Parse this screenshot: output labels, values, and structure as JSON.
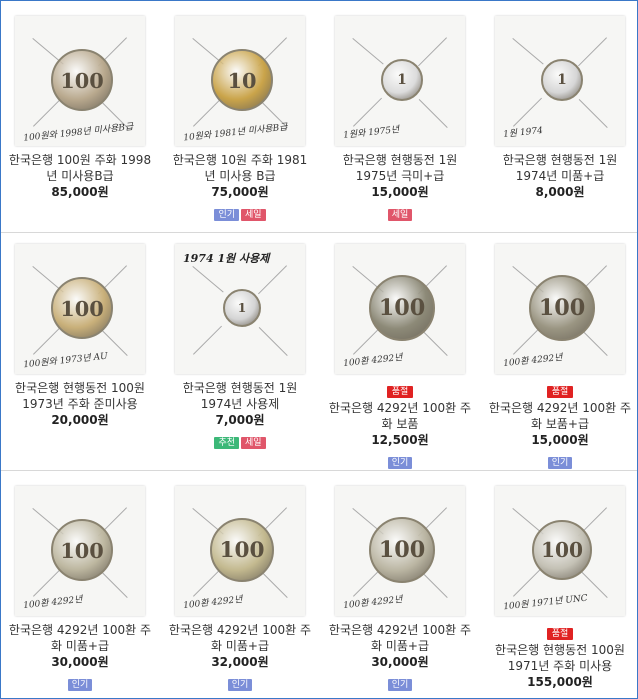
{
  "products": [
    {
      "name": "한국은행 100원 주화 1998년 미사용B급",
      "price": "85,000원",
      "badges": [],
      "sold_out": "",
      "coin_color": "#b9a98e",
      "coin_text": "100",
      "note": "100원와 1998년 미사용B급"
    },
    {
      "name": "한국은행 10원 주화 1981년 미사용 B급",
      "price": "75,000원",
      "badges": [
        "인기",
        "세일"
      ],
      "sold_out": "",
      "coin_color": "#caa44a",
      "coin_text": "10",
      "note": "10원와 1981년 미사용B급"
    },
    {
      "name": "한국은행 현행동전 1원 1975년 극미+급",
      "price": "15,000원",
      "badges": [
        "세일"
      ],
      "sold_out": "",
      "coin_color": "#dcdcdc",
      "coin_text": "1",
      "note": "1원와 1975년"
    },
    {
      "name": "한국은행 현행동전 1원 1974년 미품+급",
      "price": "8,000원",
      "badges": [],
      "sold_out": "",
      "coin_color": "#d6d6d6",
      "coin_text": "1",
      "note": "1원 1974"
    },
    {
      "name": "한국은행 현행동전 100원 1973년 주화 준미사용",
      "price": "20,000원",
      "badges": [],
      "sold_out": "",
      "coin_color": "#c9b07a",
      "coin_text": "100",
      "note": "100원와 1973년 AU"
    },
    {
      "name": "한국은행 현행동전 1원 1974년 사용제",
      "price": "7,000원",
      "badges": [
        "추천",
        "세일"
      ],
      "sold_out": "",
      "coin_color": "#d4d4d4",
      "coin_text": "1",
      "note": "1974 1원 사용제"
    },
    {
      "name": "한국은행 4292년 100환 주화 보품",
      "price": "12,500원",
      "badges": [
        "인기"
      ],
      "sold_out": "품절",
      "coin_color": "#8d8a78",
      "coin_text": "100",
      "note": "100환 4292년"
    },
    {
      "name": "한국은행 4292년 100환 주화 보품+급",
      "price": "15,000원",
      "badges": [
        "인기"
      ],
      "sold_out": "품절",
      "coin_color": "#9a9582",
      "coin_text": "100",
      "note": "100환 4292년"
    },
    {
      "name": "한국은행 4292년 100환 주화 미품+급",
      "price": "30,000원",
      "badges": [
        "인기"
      ],
      "sold_out": "",
      "coin_color": "#bdb7a0",
      "coin_text": "100",
      "note": "100환 4292년"
    },
    {
      "name": "한국은행 4292년 100환 주화 미품+급",
      "price": "32,000원",
      "badges": [
        "인기"
      ],
      "sold_out": "",
      "coin_color": "#c3b98f",
      "coin_text": "100",
      "note": "100환 4292년"
    },
    {
      "name": "한국은행 4292년 100환 주화 미품+급",
      "price": "30,000원",
      "badges": [
        "인기"
      ],
      "sold_out": "",
      "coin_color": "#bab5a2",
      "coin_text": "100",
      "note": "100환 4292년"
    },
    {
      "name": "한국은행 현행동전 100원 1971년 주화 미사용",
      "price": "155,000원",
      "badges": [],
      "sold_out": "품절",
      "coin_color": "#c4c1b5",
      "coin_text": "100",
      "note": "100원 1971년 UNC"
    }
  ],
  "badge_colors": {
    "인기": "#7b8ed8",
    "세일": "#e0566a",
    "추천": "#3cb878"
  }
}
